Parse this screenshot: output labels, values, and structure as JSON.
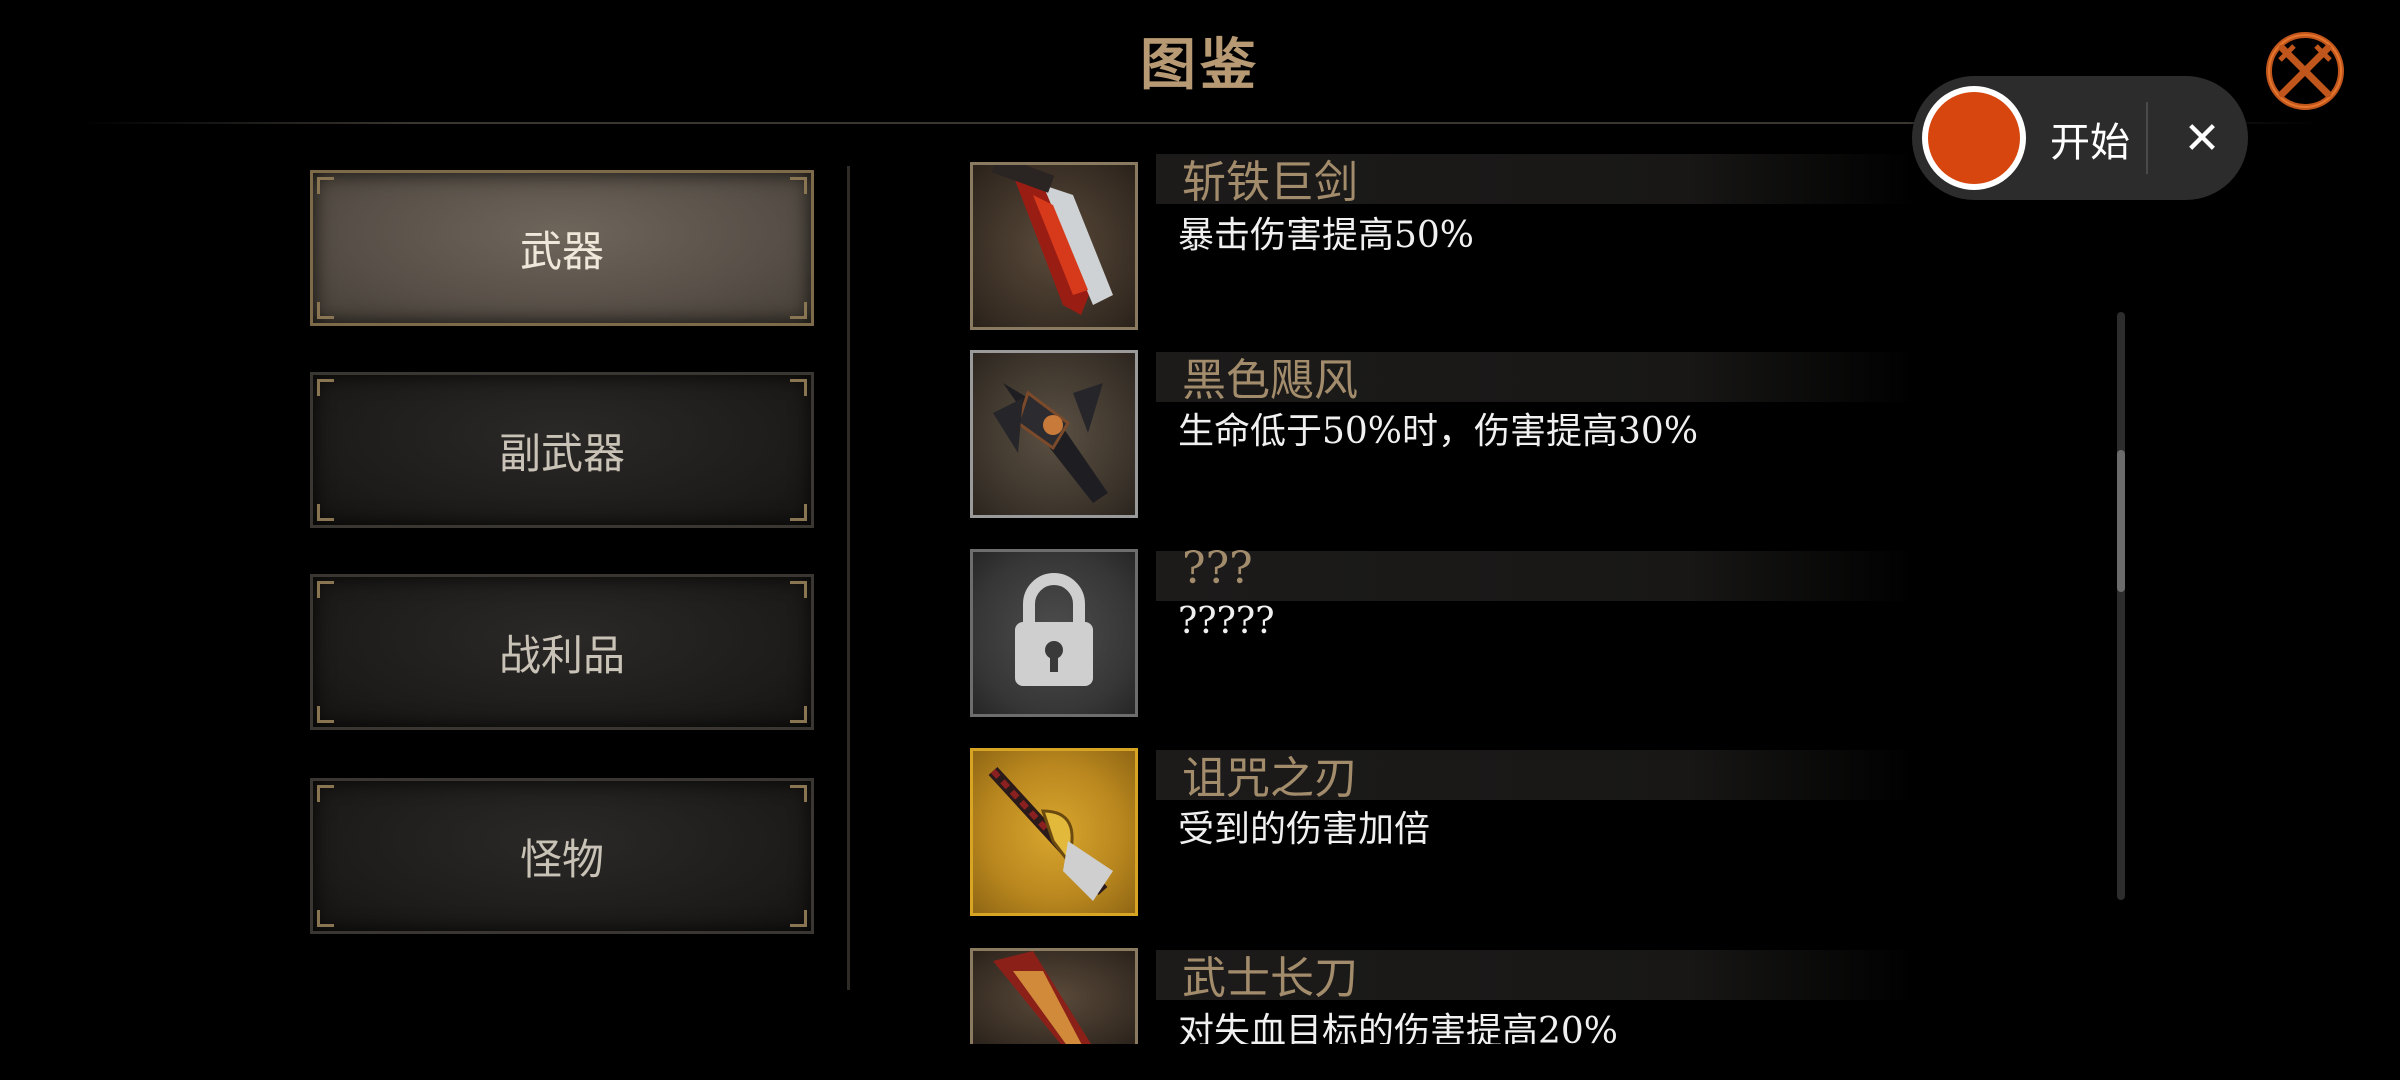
{
  "header": {
    "title": "图鉴"
  },
  "tabs": [
    {
      "label": "武器",
      "active": true
    },
    {
      "label": "副武器",
      "active": false
    },
    {
      "label": "战利品",
      "active": false
    },
    {
      "label": "怪物",
      "active": false
    }
  ],
  "entries": [
    {
      "name": "斩铁巨剑",
      "desc": "暴击伤害提高50%",
      "icon": "great-sword-icon"
    },
    {
      "name": "黑色飓风",
      "desc": "生命低于50%时，伤害提高30%",
      "icon": "black-axe-icon"
    },
    {
      "name": "???",
      "desc": "?????",
      "icon": "padlock-icon"
    },
    {
      "name": "诅咒之刃",
      "desc": "受到的伤害加倍",
      "icon": "cursed-blade-icon"
    },
    {
      "name": "武士长刀",
      "desc": "对失血目标的伤害提高20%",
      "icon": "katana-icon"
    }
  ],
  "recorder": {
    "start_label": "开始",
    "close_symbol": "✕",
    "accent": "#d6460e"
  },
  "scroll": {
    "position_fraction": 0.31
  },
  "corner_close": {
    "icon": "crossed-swords-close-icon",
    "accent": "#c0561c"
  }
}
